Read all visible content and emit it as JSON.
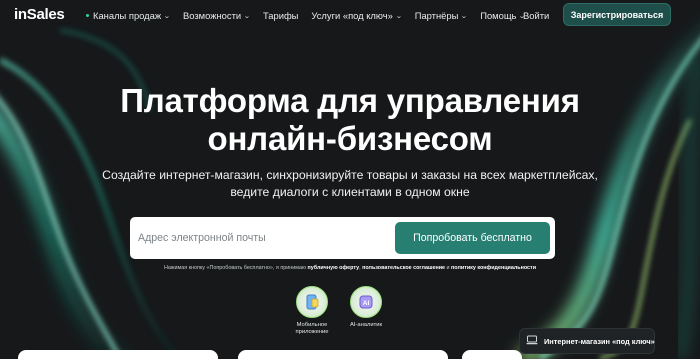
{
  "brand": {
    "logo_text": "inSales"
  },
  "nav": {
    "items": [
      {
        "label": "Каналы продаж",
        "has_dropdown": true,
        "marked": true
      },
      {
        "label": "Возможности",
        "has_dropdown": true,
        "marked": false
      },
      {
        "label": "Тарифы",
        "has_dropdown": false,
        "marked": false
      },
      {
        "label": "Услуги «под ключ»",
        "has_dropdown": true,
        "marked": false
      },
      {
        "label": "Партнёры",
        "has_dropdown": true,
        "marked": false
      },
      {
        "label": "Помощь",
        "has_dropdown": true,
        "marked": false
      }
    ],
    "login_label": "Войти",
    "register_label": "Зарегистрироваться"
  },
  "hero": {
    "title_line1": "Платформа для управления",
    "title_line2": "онлайн-бизнесом",
    "subtitle_line1": "Создайте интернет-магазин, синхронизируйте товары и заказы на всех маркетплейсах,",
    "subtitle_line2": "ведите диалоги с клиентами в одном окне"
  },
  "signup": {
    "email_placeholder": "Адрес электронной почты",
    "button_label": "Попробовать бесплатно"
  },
  "consent": {
    "prefix": "Нажимая кнопку «Попробовать бесплатно», я принимаю ",
    "offer": "публичную оферту",
    "sep1": ", ",
    "agreement": "пользовательское соглашение",
    "sep2": " и ",
    "privacy": "политику конфиденциальности"
  },
  "apps": [
    {
      "label_line1": "Мобильное",
      "label_line2": "приложение",
      "icon": "mobile-app-icon"
    },
    {
      "label_line1": "AI-аналитик",
      "label_line2": "",
      "icon": "ai-analyst-icon"
    }
  ],
  "toast": {
    "label": "Интернет-магазин «под ключ»",
    "icon": "laptop-icon"
  },
  "colors": {
    "background": "#16181a",
    "accent": "#277f72",
    "brand_dot": "#2ecfa5",
    "glow": "#3de0c0"
  }
}
